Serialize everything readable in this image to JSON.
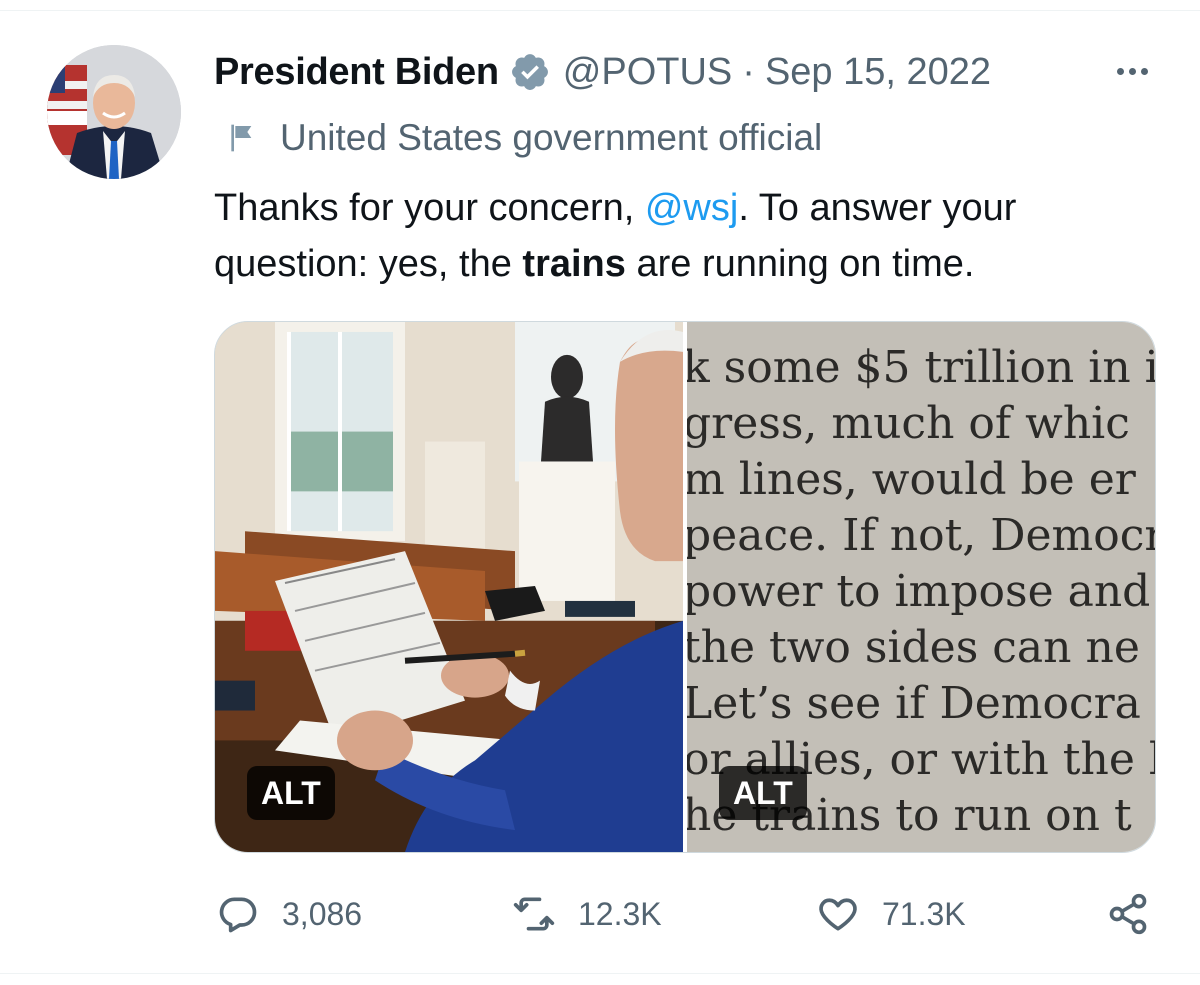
{
  "tweet": {
    "author": {
      "display_name": "President Biden",
      "handle": "@POTUS",
      "verified_icon": "verified-badge-icon",
      "label": "United States government official",
      "label_icon": "flag-icon"
    },
    "separator": "·",
    "date": "Sep 15, 2022",
    "more_icon": "more-dots-icon",
    "text": {
      "part1": "Thanks for your concern, ",
      "mention": "@wsj",
      "part2": ". To answer your question: yes, the ",
      "bold": "trains",
      "part3": " are running on time."
    },
    "media": [
      {
        "kind": "photo",
        "alt_badge": "ALT"
      },
      {
        "kind": "photo",
        "alt_badge": "ALT",
        "clipping_lines": [
          "k some $5 trillion in i",
          "gress, much of whic",
          "m lines, would be er",
          "peace. If not, Democra",
          " power to impose and",
          " the two sides can ne",
          " Let’s see if Democra",
          "or allies, or with the l",
          "he trains to run on t"
        ]
      }
    ],
    "actions": {
      "reply": {
        "icon": "reply-icon",
        "count": "3,086"
      },
      "retweet": {
        "icon": "retweet-icon",
        "count": "12.3K"
      },
      "like": {
        "icon": "heart-icon",
        "count": "71.3K"
      },
      "share": {
        "icon": "share-icon"
      }
    },
    "colors": {
      "accent": "#1d9bf0",
      "secondary_text": "#536471",
      "primary_text": "#0f1419",
      "verified_badge": "#829aab"
    }
  }
}
